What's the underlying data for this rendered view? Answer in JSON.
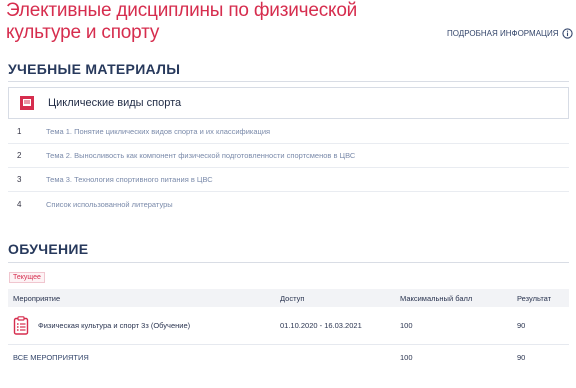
{
  "page": {
    "title": "Элективные дисциплины по физической культуре и спорту",
    "more_info": "ПОДРОБНАЯ ИНФОРМАЦИЯ"
  },
  "materials": {
    "heading": "УЧЕБНЫЕ МАТЕРИАЛЫ",
    "course_name": "Циклические виды спорта",
    "topics": [
      {
        "num": "1",
        "label": "Тема 1. Понятие циклических видов спорта и их классификация"
      },
      {
        "num": "2",
        "label": "Тема 2. Выносливость как компонент физической подготовленности спортсменов в ЦВС"
      },
      {
        "num": "3",
        "label": "Тема 3. Технология спортивного питания в ЦВС"
      },
      {
        "num": "4",
        "label": "Список использованной литературы"
      }
    ]
  },
  "learning": {
    "heading": "ОБУЧЕНИЕ",
    "tag": "Текущее",
    "columns": {
      "event": "Мероприятие",
      "access": "Доступ",
      "max": "Максимальный балл",
      "result": "Результат"
    },
    "rows": [
      {
        "event": "Физическая культура и спорт 3з (Обучение)",
        "access": "01.10.2020 - 16.03.2021",
        "max": "100",
        "result": "90"
      }
    ],
    "footer": {
      "label": "ВСЕ МЕРОПРИЯТИЯ",
      "max": "100",
      "result": "90"
    }
  },
  "colors": {
    "accent": "#d62d4e",
    "heading": "#27395c",
    "link": "#7a8aaa"
  },
  "icons": {
    "more": "info-circle-icon",
    "course": "book-icon",
    "event": "checklist-icon"
  }
}
